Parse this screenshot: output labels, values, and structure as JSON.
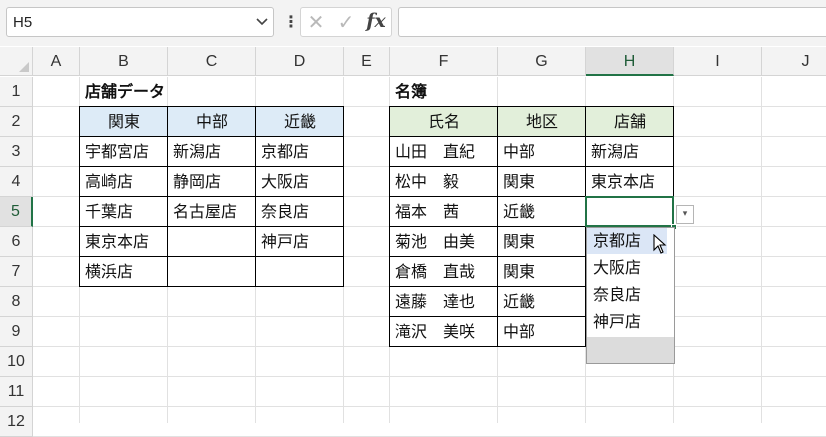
{
  "formula_bar": {
    "name_box": "H5",
    "dots": "⋮",
    "cancel_icon": "✕",
    "enter_icon": "✓",
    "fx_label": "fx",
    "formula": ""
  },
  "columns": [
    "A",
    "B",
    "C",
    "D",
    "E",
    "F",
    "G",
    "H",
    "I",
    "J"
  ],
  "rows": [
    "1",
    "2",
    "3",
    "4",
    "5",
    "6",
    "7",
    "8",
    "9",
    "10",
    "11",
    "12"
  ],
  "selected_cell": "H5",
  "store_table": {
    "title": "店舗データ",
    "headers": [
      "関東",
      "中部",
      "近畿"
    ],
    "header_fill": "#ddebf7",
    "rows": [
      [
        "宇都宮店",
        "新潟店",
        "京都店"
      ],
      [
        "高崎店",
        "静岡店",
        "大阪店"
      ],
      [
        "千葉店",
        "名古屋店",
        "奈良店"
      ],
      [
        "東京本店",
        "",
        "神戸店"
      ],
      [
        "横浜店",
        "",
        ""
      ]
    ]
  },
  "roster_table": {
    "title": "名簿",
    "headers": [
      "氏名",
      "地区",
      "店舗"
    ],
    "header_fill": "#e2efda",
    "rows": [
      [
        "山田　直紀",
        "中部",
        "新潟店"
      ],
      [
        "松中　毅",
        "関東",
        "東京本店"
      ],
      [
        "福本　茜",
        "近畿",
        ""
      ],
      [
        "菊池　由美",
        "関東",
        ""
      ],
      [
        "倉橋　直哉",
        "関東",
        ""
      ],
      [
        "遠藤　達也",
        "近畿",
        ""
      ],
      [
        "滝沢　美咲",
        "中部",
        ""
      ]
    ]
  },
  "dropdown": {
    "arrow": "▾",
    "options": [
      "京都店",
      "大阪店",
      "奈良店",
      "神戸店"
    ],
    "highlighted_index": 0
  },
  "colors": {
    "accent": "#217346",
    "gridline": "#e1e1e1",
    "header_bg": "#f3f3f3"
  }
}
